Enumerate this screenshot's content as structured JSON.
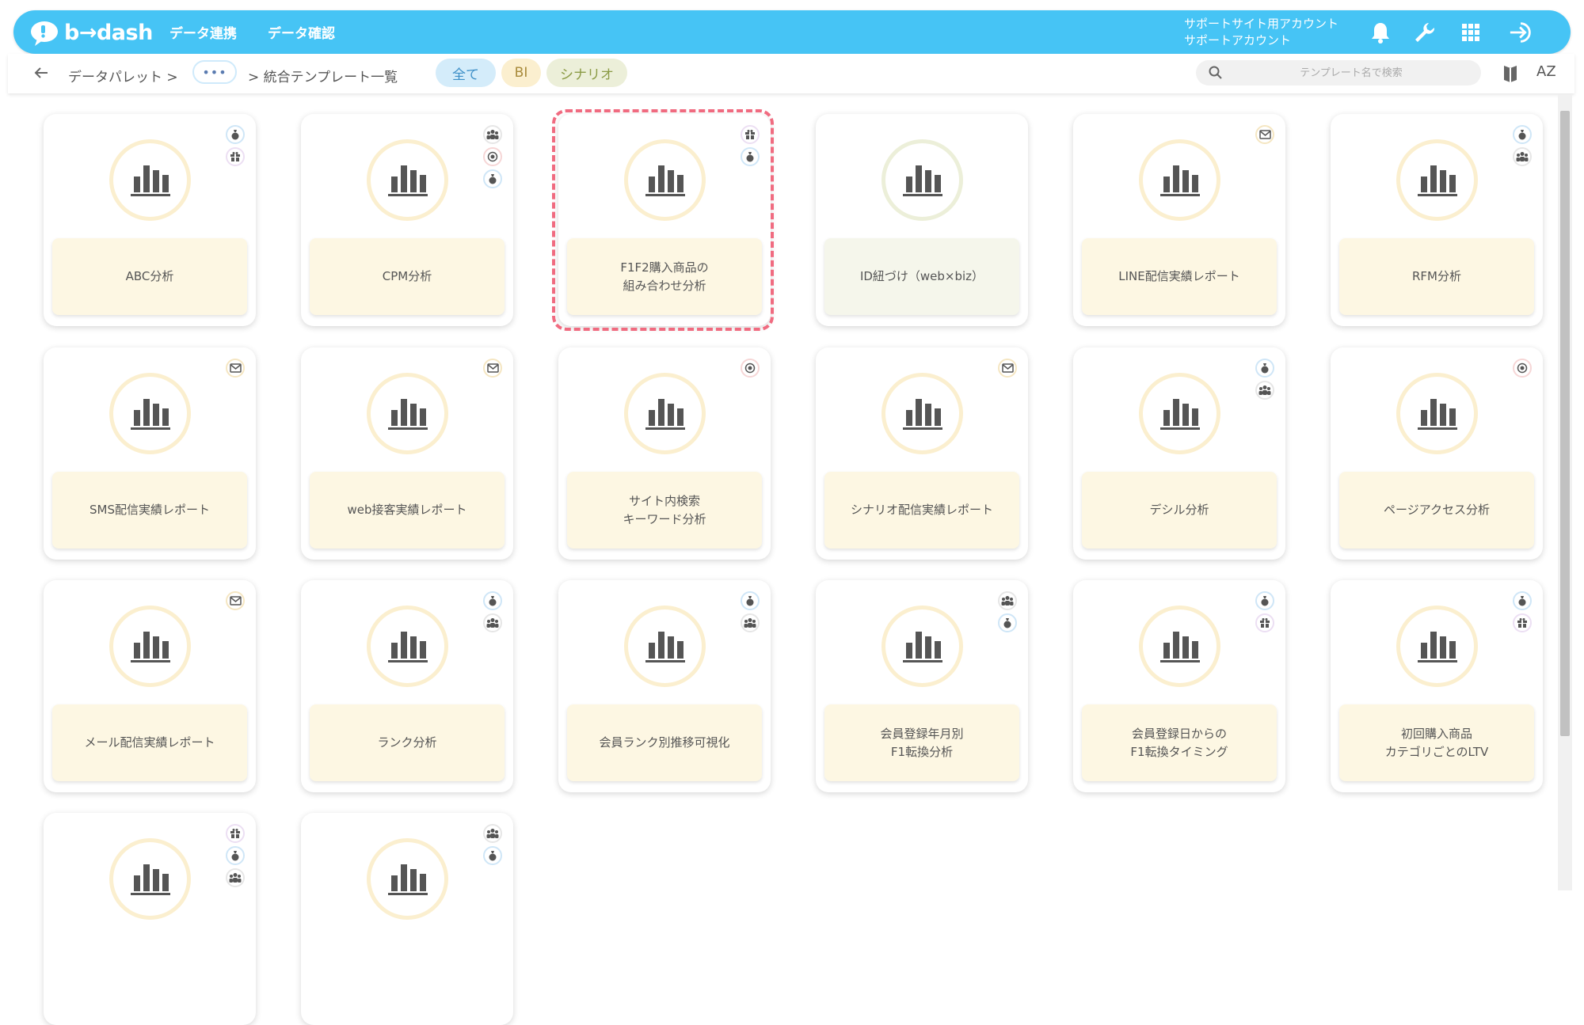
{
  "app": {
    "logo_text": "b→dash"
  },
  "nav": [
    "データ連携",
    "データ確認"
  ],
  "account": {
    "line1": "サポートサイト用アカウント",
    "line2": "サポートアカウント"
  },
  "top_icons": [
    "bell-icon",
    "wrench-icon",
    "grid-icon",
    "logout-icon"
  ],
  "breadcrumb": {
    "root": "データパレット >",
    "more": "•••",
    "current": "> 統合テンプレート一覧"
  },
  "filters": [
    {
      "label": "全て",
      "color": "#d4ecfa",
      "text_color": "#3d8fc7",
      "active": true
    },
    {
      "label": "BI",
      "color": "#fbefcf",
      "text_color": "#a88a3a",
      "active": false
    },
    {
      "label": "シナリオ",
      "color": "#ecefd9",
      "text_color": "#8b9b45",
      "active": false
    }
  ],
  "search": {
    "placeholder": "テンプレート名で検索"
  },
  "toolbar_right": {
    "sort_label": "AZ"
  },
  "colors": {
    "accent": "#46c4f5",
    "card_ring": "#fbefcf",
    "card_label_bg": "#fdf7e3",
    "highlight": "#f06b80"
  },
  "templates": [
    {
      "name": "ABC分析",
      "badges": [
        "money",
        "gift"
      ]
    },
    {
      "name": "CPM分析",
      "badges": [
        "users",
        "target",
        "money"
      ]
    },
    {
      "name": "F1F2購入商品の\n組み合わせ分析",
      "badges": [
        "gift",
        "money"
      ],
      "highlighted": true
    },
    {
      "name": "ID紐づけ（web×biz）",
      "badges": [],
      "variant": "green"
    },
    {
      "name": "LINE配信実績レポート",
      "badges": [
        "mail"
      ]
    },
    {
      "name": "RFM分析",
      "badges": [
        "money",
        "users"
      ]
    },
    {
      "name": "SMS配信実績レポート",
      "badges": [
        "mail"
      ]
    },
    {
      "name": "web接客実績レポート",
      "badges": [
        "mail"
      ]
    },
    {
      "name": "サイト内検索\nキーワード分析",
      "badges": [
        "target"
      ]
    },
    {
      "name": "シナリオ配信実績レポート",
      "badges": [
        "mail"
      ]
    },
    {
      "name": "デシル分析",
      "badges": [
        "money",
        "users"
      ]
    },
    {
      "name": "ページアクセス分析",
      "badges": [
        "target"
      ]
    },
    {
      "name": "メール配信実績レポート",
      "badges": [
        "mail"
      ]
    },
    {
      "name": "ランク分析",
      "badges": [
        "money",
        "users"
      ]
    },
    {
      "name": "会員ランク別推移可視化",
      "badges": [
        "money",
        "users"
      ]
    },
    {
      "name": "会員登録年月別\nF1転換分析",
      "badges": [
        "users",
        "money"
      ]
    },
    {
      "name": "会員登録日からの\nF1転換タイミング",
      "badges": [
        "money",
        "gift"
      ]
    },
    {
      "name": "初回購入商品\nカテゴリごとのLTV",
      "badges": [
        "money",
        "gift"
      ]
    },
    {
      "name": "",
      "badges": [
        "gift",
        "money",
        "users"
      ]
    },
    {
      "name": "",
      "badges": [
        "users",
        "money"
      ]
    }
  ]
}
